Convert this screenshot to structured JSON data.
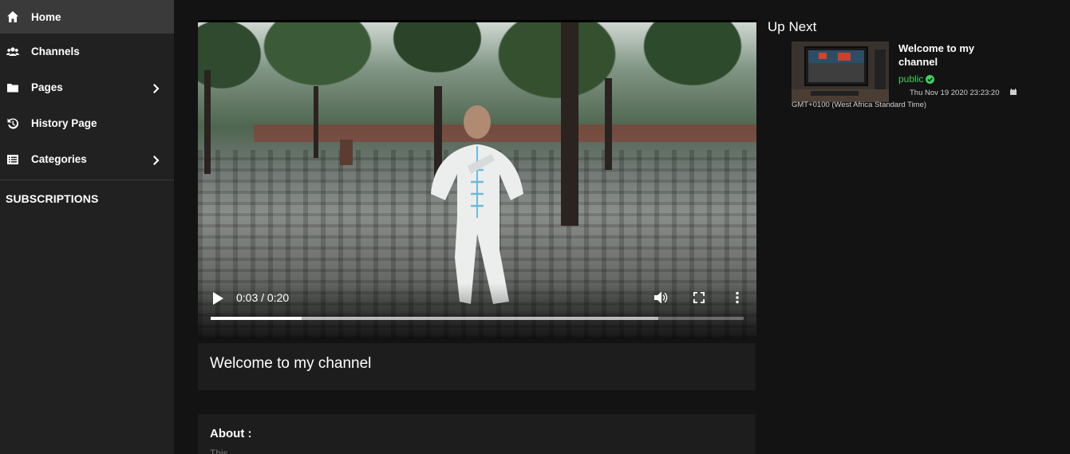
{
  "sidebar": {
    "items": [
      {
        "label": "Home",
        "icon": "home-icon",
        "active": true,
        "has_submenu": false
      },
      {
        "label": "Channels",
        "icon": "users-icon",
        "active": false,
        "has_submenu": false
      },
      {
        "label": "Pages",
        "icon": "folder-icon",
        "active": false,
        "has_submenu": true
      },
      {
        "label": "History Page",
        "icon": "history-icon",
        "active": false,
        "has_submenu": false
      },
      {
        "label": "Categories",
        "icon": "list-icon",
        "active": false,
        "has_submenu": true
      }
    ],
    "subscriptions_heading": "SUBSCRIPTIONS"
  },
  "player": {
    "current_time": "0:03 / 0:20",
    "played_fraction": 0.17,
    "buffered_fraction": 0.84
  },
  "video": {
    "title": "Welcome to my channel"
  },
  "about": {
    "heading": "About :",
    "text": "This ..."
  },
  "up_next": {
    "heading": "Up Next",
    "items": [
      {
        "title": "Welcome to my channel",
        "status": "public",
        "date": "Thu Nov 19 2020 23:23:20 GMT+0100 (West Africa Standard Time)"
      }
    ]
  },
  "colors": {
    "background": "#131313",
    "sidebar": "#212121",
    "sidebar_active": "#3a3a3a",
    "card": "#1d1d1d",
    "status_public": "#3fd15c"
  }
}
